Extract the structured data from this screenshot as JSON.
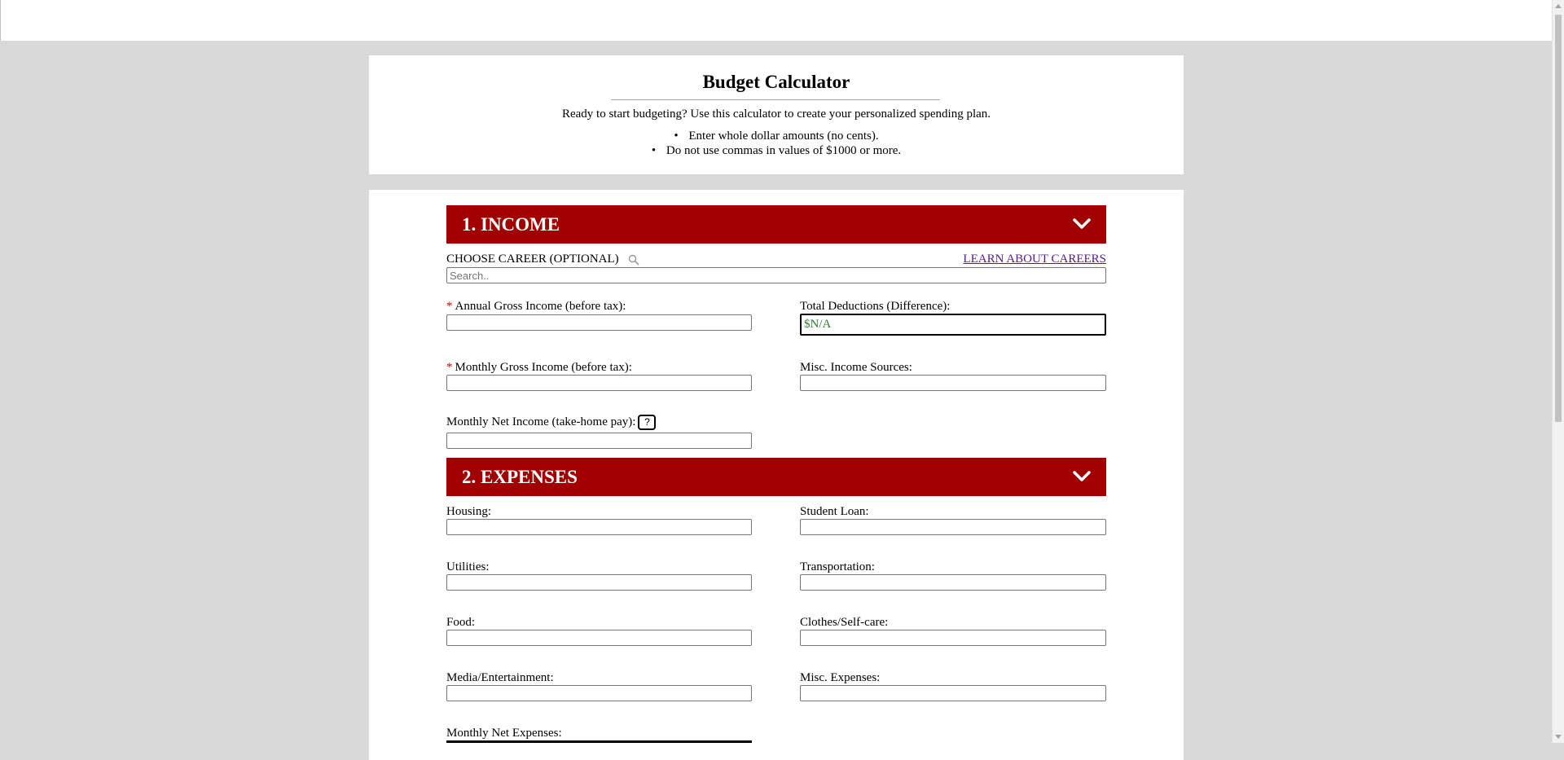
{
  "header": {
    "title": "Budget Calculator",
    "description": "Ready to start budgeting? Use this calculator to create your personalized spending plan.",
    "tips": [
      "Enter whole dollar amounts (no cents).",
      "Do not use commas in values of $1000 or more."
    ]
  },
  "income": {
    "section_title": "1. INCOME",
    "career_label": "CHOOSE CAREER (OPTIONAL)",
    "learn_link": "LEARN ABOUT CAREERS",
    "search_placeholder": "Search..",
    "annual_gross_label": "Annual Gross Income (before tax):",
    "monthly_gross_label": "Monthly Gross Income (before tax):",
    "monthly_net_label": "Monthly Net Income (take-home pay):",
    "help_label": "?",
    "total_deductions_label": "Total Deductions (Difference):",
    "total_deductions_value": "$N/A",
    "misc_income_label": "Misc. Income Sources:",
    "required_marker": "*"
  },
  "expenses": {
    "section_title": "2. EXPENSES",
    "housing_label": "Housing:",
    "student_loan_label": "Student Loan:",
    "utilities_label": "Utilities:",
    "transportation_label": "Transportation:",
    "food_label": "Food:",
    "clothes_label": "Clothes/Self-care:",
    "media_label": "Media/Entertainment:",
    "misc_expenses_label": "Misc. Expenses:",
    "monthly_net_expenses_label": "Monthly Net Expenses:"
  },
  "colors": {
    "section_header": "#a00000",
    "deductions_text": "#2e7d32",
    "link": "#551a8b"
  }
}
